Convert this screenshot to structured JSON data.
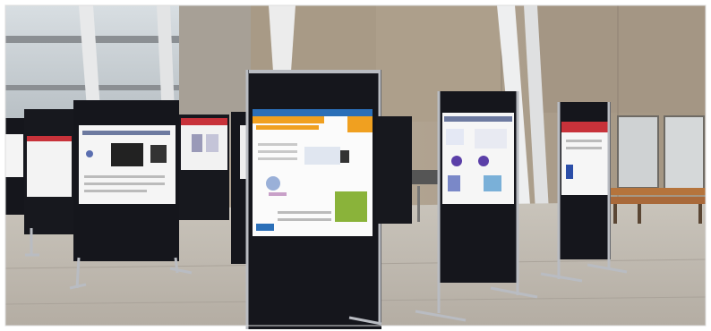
{
  "scene": {
    "description_free": true,
    "colors": {
      "floor": "#bfb9b0",
      "wall": "#a89c8c",
      "board": "#15161c",
      "frame": "#b9bcc2",
      "bench": "#b5743c",
      "poster_orange": "#f0a020",
      "poster_red": "#c8323a",
      "poster_blue": "#2b6fb8",
      "poster_green": "#8ab33a"
    },
    "poster_boards": [
      {
        "id": "far-left"
      },
      {
        "id": "left"
      },
      {
        "id": "center-left"
      },
      {
        "id": "center-back"
      },
      {
        "id": "front-center"
      },
      {
        "id": "back-center"
      },
      {
        "id": "right-center"
      },
      {
        "id": "far-right"
      }
    ]
  }
}
